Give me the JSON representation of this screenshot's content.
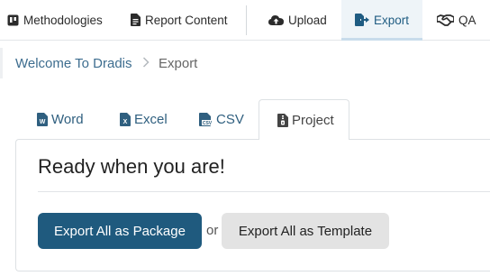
{
  "nav": {
    "items": [
      {
        "label": "Methodologies",
        "icon": "board-icon"
      },
      {
        "label": "Report Content",
        "icon": "file-icon"
      },
      {
        "label": "Upload",
        "icon": "cloud-upload-icon"
      },
      {
        "label": "Export",
        "icon": "file-export-icon",
        "active": true
      },
      {
        "label": "QA",
        "icon": "handshake-icon"
      }
    ]
  },
  "breadcrumb": {
    "home": "Welcome To Dradis",
    "current": "Export"
  },
  "tabs": [
    {
      "label": "Word",
      "icon": "word-file-icon"
    },
    {
      "label": "Excel",
      "icon": "excel-file-icon"
    },
    {
      "label": "CSV",
      "icon": "csv-file-icon"
    },
    {
      "label": "Project",
      "icon": "archive-file-icon",
      "active": true
    }
  ],
  "panel": {
    "title": "Ready when you are!",
    "primary_button": "Export All as Package",
    "or": "or",
    "secondary_button": "Export All as Template"
  },
  "colors": {
    "accent": "#1f5a7e",
    "link": "#3d6d8f",
    "active_nav_bg": "#eef4f8"
  }
}
